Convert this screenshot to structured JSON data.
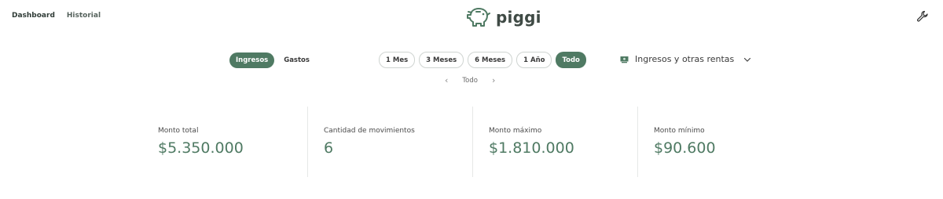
{
  "nav": {
    "dashboard": "Dashboard",
    "historial": "Historial"
  },
  "brand": {
    "name": "piggi",
    "icon": "piggy-bank-icon",
    "color": "#4f7a63"
  },
  "settings_icon": "wrench-icon",
  "type_filter": {
    "options": [
      "Ingresos",
      "Gastos"
    ],
    "selected": "Ingresos"
  },
  "range_filter": {
    "options": [
      "1 Mes",
      "3 Meses",
      "6 Meses",
      "1 Año",
      "Todo"
    ],
    "selected": "Todo"
  },
  "category_select": {
    "icon": "money-icon",
    "value": "Ingresos y otras rentas"
  },
  "period": {
    "label": "Todo",
    "prev_icon": "chevron-left-icon",
    "next_icon": "chevron-right-icon"
  },
  "stats": [
    {
      "label": "Monto total",
      "value": "$5.350.000"
    },
    {
      "label": "Cantidad de movimientos",
      "value": "6"
    },
    {
      "label": "Monto máximo",
      "value": "$1.810.000"
    },
    {
      "label": "Monto mínimo",
      "value": "$90.600"
    }
  ]
}
